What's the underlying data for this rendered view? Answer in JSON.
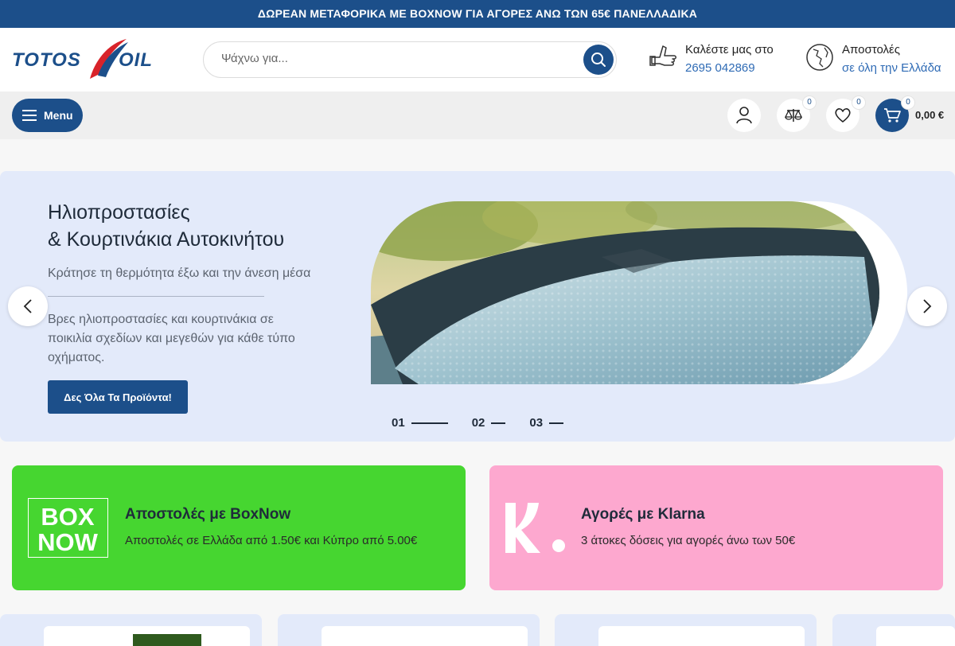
{
  "topbar": {
    "text": "ΔΩΡΕΑΝ ΜΕΤΑΦΟΡΙΚΑ ΜΕ BOXNOW ΓΙΑ ΑΓΟΡΕΣ ΑΝΩ ΤΩΝ 65€ ΠΑΝΕΛΛΑΔΙΚΑ"
  },
  "header": {
    "logo_text": "TOTOS OIL",
    "search": {
      "placeholder": "Ψάχνω για...",
      "value": ""
    },
    "phone": {
      "label": "Καλέστε μας στο",
      "number": "2695 042869",
      "icon": "phone-hand-icon"
    },
    "shipping": {
      "label": "Αποστολές",
      "value": "σε όλη την Ελλάδα",
      "icon": "globe-icon"
    }
  },
  "nav": {
    "menu_label": "Menu",
    "compare_count": "0",
    "wishlist_count": "0",
    "cart_count": "0",
    "cart_total": "0,00 €"
  },
  "hero": {
    "title_line1": "Ηλιοπροστασίες",
    "title_line2": "& Κουρτινάκια Αυτοκινήτου",
    "subtitle": "Κράτησε τη θερμότητα έξω και την άνεση μέσα",
    "description": "Βρες ηλιοπροστασίες και κουρτινάκια σε ποικιλία σχεδίων και μεγεθών για κάθε τύπο οχήματος.",
    "cta": "Δες Όλα Τα Προϊόντα!",
    "slides": [
      "01",
      "02",
      "03"
    ],
    "active_slide": "01"
  },
  "promos": [
    {
      "logo": "BOX NOW",
      "title": "Αποστολές με BoxNow",
      "text": "Αποστολές σε Ελλάδα από 1.50€ και Κύπρο από 5.00€",
      "color": "#46d630"
    },
    {
      "logo": "K.",
      "title": "Αγορές με Klarna",
      "text": "3 άτοκες δόσεις για αγορές άνω των 50€",
      "color": "#fda8cf"
    }
  ],
  "colors": {
    "brand": "#1c4f8a",
    "link": "#2f6bb5",
    "hero_bg": "#e3eafa"
  }
}
